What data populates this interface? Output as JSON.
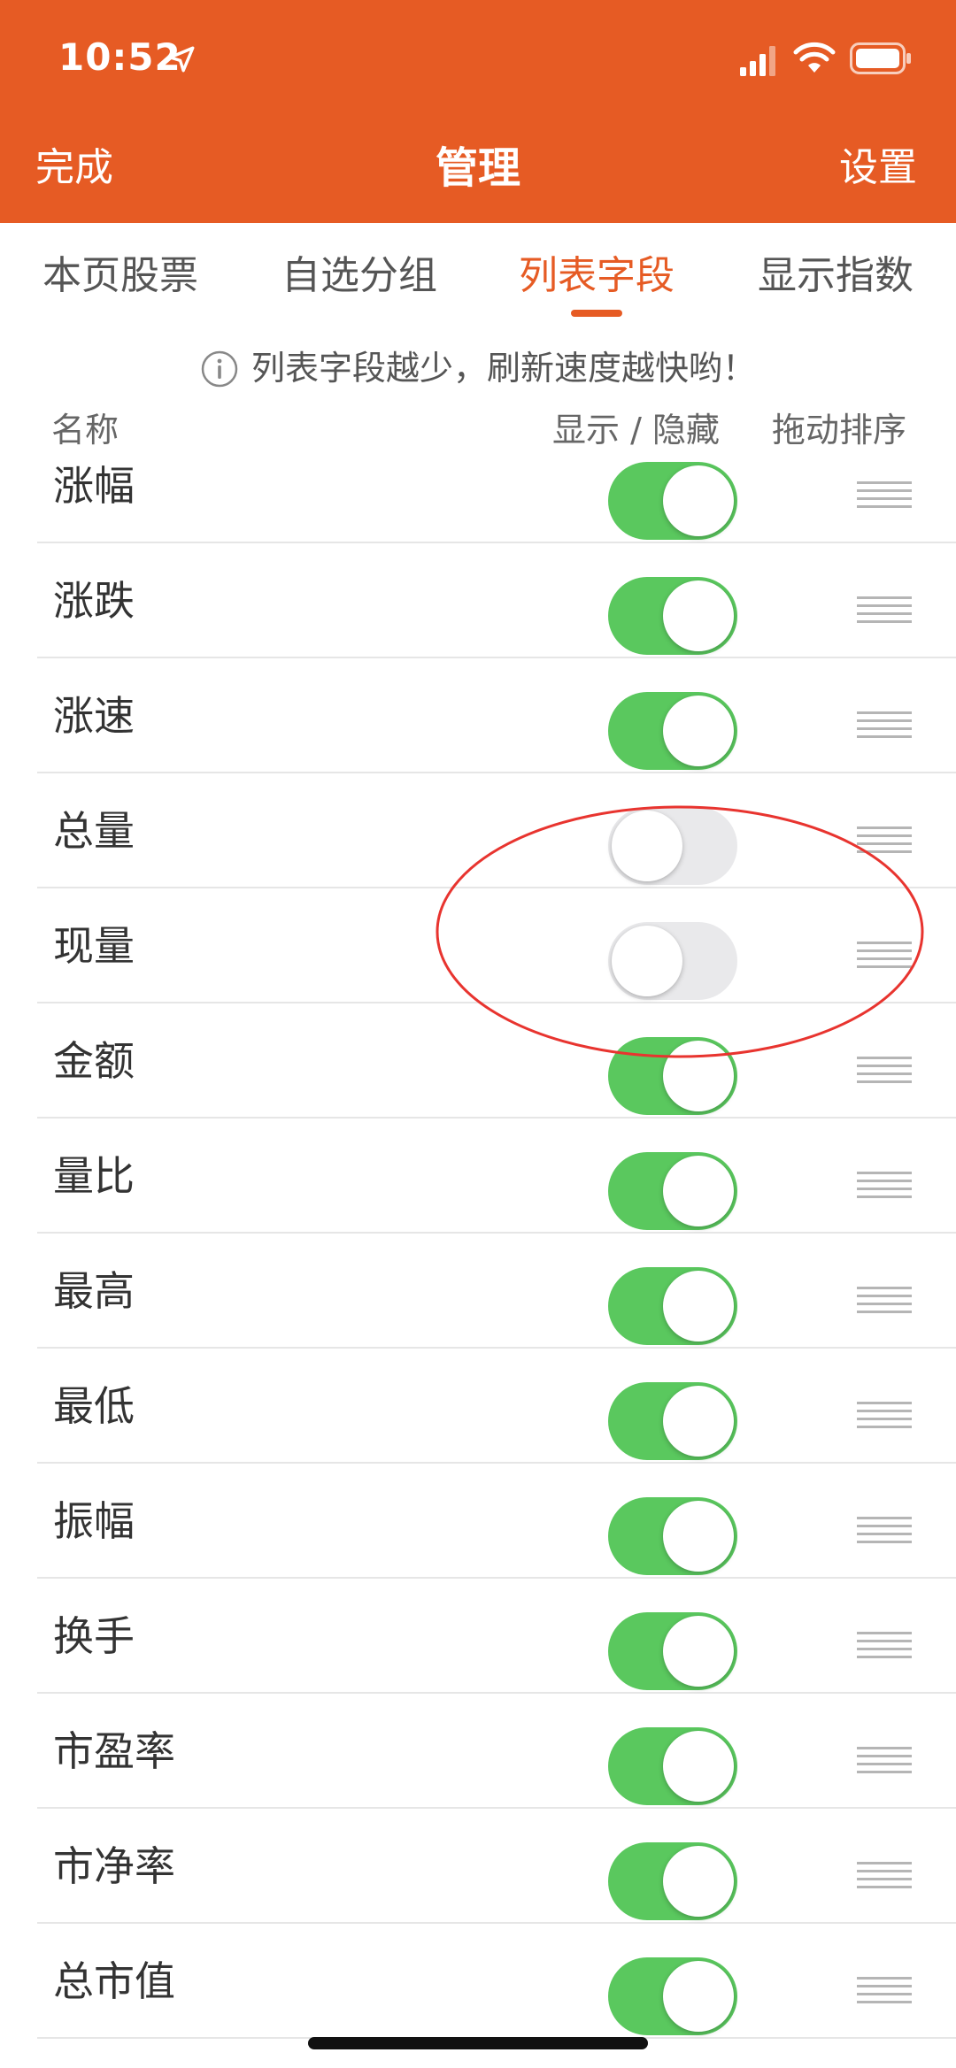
{
  "status": {
    "time": "10:52"
  },
  "nav": {
    "left": "完成",
    "title": "管理",
    "right": "设置"
  },
  "tabs": [
    {
      "label": "本页股票",
      "active": false
    },
    {
      "label": "自选分组",
      "active": false
    },
    {
      "label": "列表字段",
      "active": true
    },
    {
      "label": "显示指数",
      "active": false
    }
  ],
  "tip": "列表字段越少，刷新速度越快哟！",
  "columns": {
    "name": "名称",
    "toggle": "显示 / 隐藏",
    "sort": "拖动排序"
  },
  "rows": [
    {
      "label": "涨幅",
      "on": true
    },
    {
      "label": "涨跌",
      "on": true
    },
    {
      "label": "涨速",
      "on": true
    },
    {
      "label": "总量",
      "on": false
    },
    {
      "label": "现量",
      "on": false
    },
    {
      "label": "金额",
      "on": true
    },
    {
      "label": "量比",
      "on": true
    },
    {
      "label": "最高",
      "on": true
    },
    {
      "label": "最低",
      "on": true
    },
    {
      "label": "振幅",
      "on": true
    },
    {
      "label": "换手",
      "on": true
    },
    {
      "label": "市盈率",
      "on": true
    },
    {
      "label": "市净率",
      "on": true
    },
    {
      "label": "总市值",
      "on": true
    }
  ],
  "colors": {
    "accent": "#e65b24",
    "toggle_on": "#5ac85e",
    "toggle_off": "#e9e9eb",
    "annotation": "#e8342f"
  }
}
